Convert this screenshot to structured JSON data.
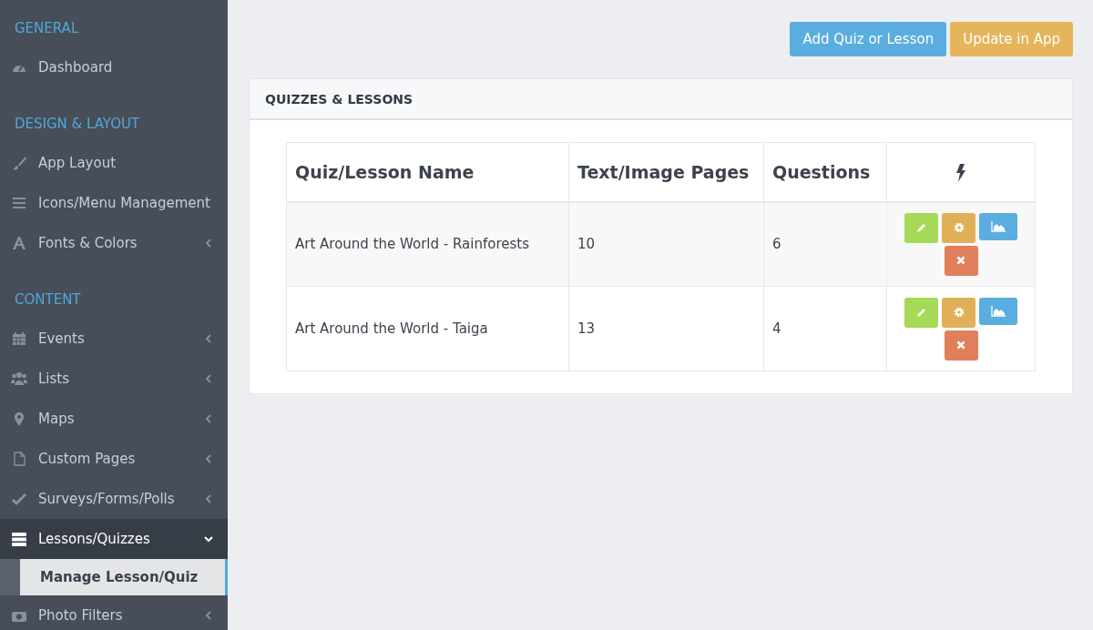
{
  "sidebar": {
    "items": [
      {
        "kind": "header",
        "label": "GENERAL"
      },
      {
        "kind": "item",
        "label": "Dashboard",
        "selected": false
      },
      {
        "kind": "header",
        "label": "DESIGN & LAYOUT"
      },
      {
        "kind": "item",
        "label": "App Layout",
        "selected": false
      },
      {
        "kind": "item",
        "label": "Icons/Menu Management",
        "selected": false
      },
      {
        "kind": "item",
        "label": "Fonts & Colors",
        "expanded": false,
        "selected": false
      },
      {
        "kind": "header",
        "label": "CONTENT"
      },
      {
        "kind": "item",
        "label": "Events",
        "expanded": false,
        "selected": false
      },
      {
        "kind": "item",
        "label": "Lists",
        "expanded": false,
        "selected": false
      },
      {
        "kind": "item",
        "label": "Maps",
        "expanded": false,
        "selected": false
      },
      {
        "kind": "item",
        "label": "Custom Pages",
        "expanded": false,
        "selected": false
      },
      {
        "kind": "item",
        "label": "Surveys/Forms/Polls",
        "expanded": false,
        "selected": false
      },
      {
        "kind": "item",
        "label": "Lessons/Quizzes",
        "expanded": true,
        "selected": true,
        "children": [
          {
            "label": "Manage Lesson/Quiz",
            "selected": true
          }
        ]
      },
      {
        "kind": "item",
        "label": "Photo Filters",
        "expanded": false,
        "selected": false
      }
    ]
  },
  "toolbar": {
    "buttons": [
      {
        "label": "Add Quiz or Lesson",
        "kind": "info"
      },
      {
        "label": "Update in App",
        "kind": "warning"
      }
    ]
  },
  "panel": {
    "title": "QUIZZES & LESSONS",
    "table": {
      "columns": [
        "Quiz/Lesson Name",
        "Text/Image Pages",
        "Questions"
      ],
      "rows": [
        {
          "name": "Art Around the World - Rainforests",
          "pages": "10",
          "questions": "6"
        },
        {
          "name": "Art Around the World - Taiga",
          "pages": "13",
          "questions": "4"
        }
      ]
    }
  }
}
